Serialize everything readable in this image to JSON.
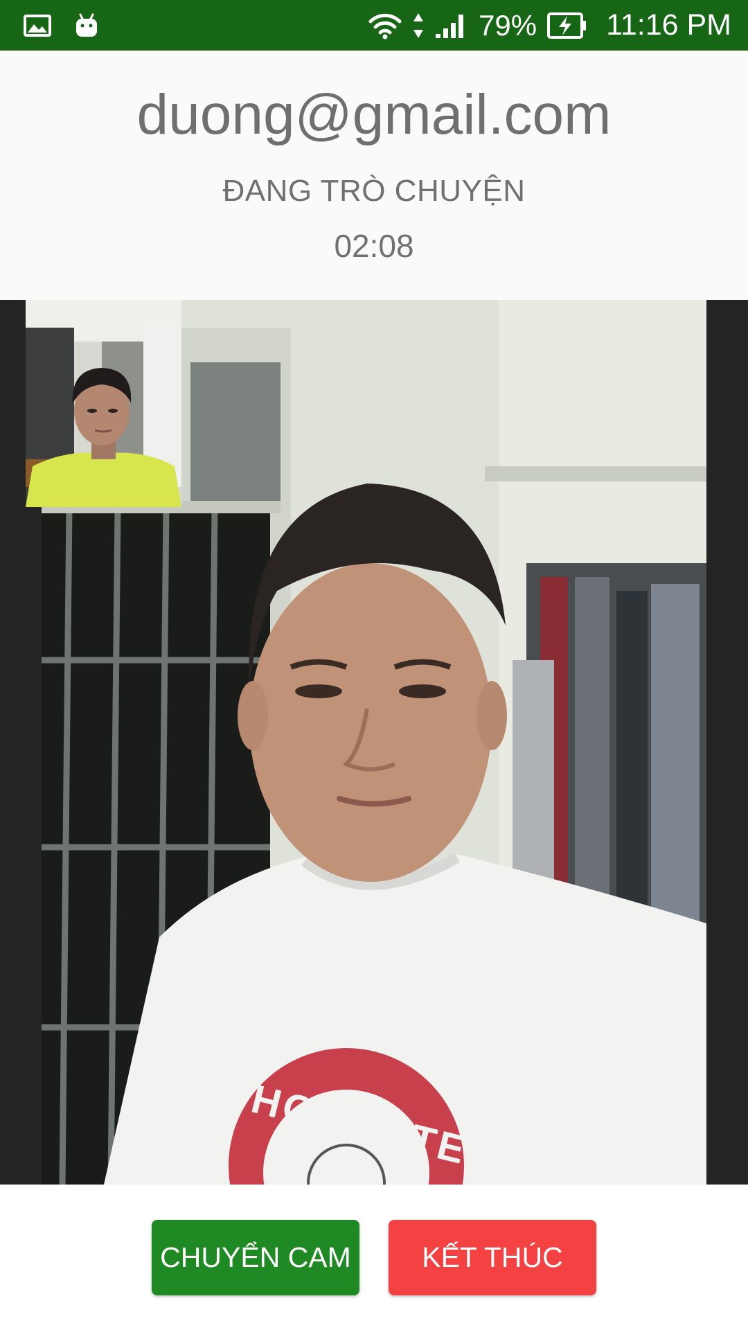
{
  "status_bar": {
    "left_icons": [
      "gallery-icon",
      "android-icon"
    ],
    "right_icons": [
      "wifi-icon",
      "data-arrows-icon",
      "cell-signal-icon",
      "battery-charging-icon"
    ],
    "battery_percent": "79%",
    "time": "11:16 PM"
  },
  "call": {
    "contact": "duong@gmail.com",
    "status": "ĐANG TRÒ CHUYỆN",
    "timer": "02:08"
  },
  "video": {
    "remote_shirt_text": "HOLLISTER"
  },
  "controls": {
    "switch_camera_label": "CHUYỂN CAM",
    "end_call_label": "KẾT THÚC"
  },
  "colors": {
    "status_bar": "#166615",
    "header_bg": "#fafafa",
    "switch_button": "#1f8a23",
    "end_button": "#f44242",
    "video_bg": "#242424"
  }
}
